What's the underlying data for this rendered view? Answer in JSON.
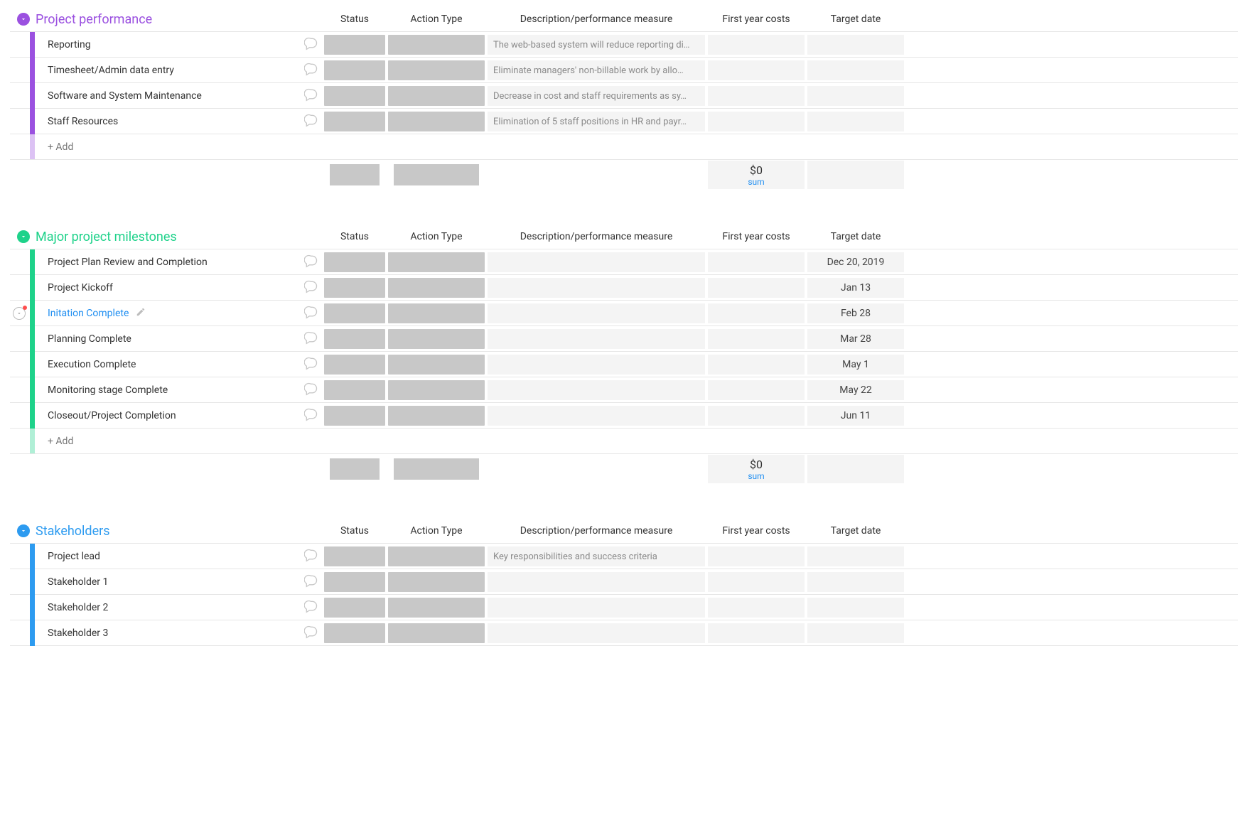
{
  "columns": {
    "status": "Status",
    "action_type": "Action Type",
    "description": "Description/performance measure",
    "first_year_costs": "First year costs",
    "target_date": "Target date"
  },
  "add_label": "+ Add",
  "summary": {
    "value": "$0",
    "label": "sum"
  },
  "groups": [
    {
      "id": "project-performance",
      "title": "Project performance",
      "title_color": "#9b51e0",
      "bar_color": "#9b51e0",
      "rows": [
        {
          "name": "Reporting",
          "description": "The web-based system will reduce reporting di…",
          "target_date": ""
        },
        {
          "name": "Timesheet/Admin data entry",
          "description": "Eliminate managers' non-billable work by allo…",
          "target_date": ""
        },
        {
          "name": "Software and System Maintenance",
          "description": "Decrease in cost and staff requirements as sy…",
          "target_date": ""
        },
        {
          "name": "Staff Resources",
          "description": "Elimination of 5 staff positions in HR and payr…",
          "target_date": ""
        }
      ],
      "show_summary": true
    },
    {
      "id": "major-project-milestones",
      "title": "Major project milestones",
      "title_color": "#1ed28a",
      "bar_color": "#1ed28a",
      "rows": [
        {
          "name": "Project Plan Review and Completion",
          "description": "",
          "target_date": "Dec 20, 2019"
        },
        {
          "name": "Project Kickoff",
          "description": "",
          "target_date": "Jan 13"
        },
        {
          "name": "Initation Complete",
          "description": "",
          "target_date": "Feb 28",
          "active": true
        },
        {
          "name": "Planning Complete",
          "description": "",
          "target_date": "Mar 28"
        },
        {
          "name": "Execution Complete",
          "description": "",
          "target_date": "May 1"
        },
        {
          "name": "Monitoring stage Complete",
          "description": "",
          "target_date": "May 22"
        },
        {
          "name": "Closeout/Project Completion",
          "description": "",
          "target_date": "Jun 11"
        }
      ],
      "show_summary": true
    },
    {
      "id": "stakeholders",
      "title": "Stakeholders",
      "title_color": "#2d9bf0",
      "bar_color": "#2d9bf0",
      "rows": [
        {
          "name": "Project lead",
          "description": "Key responsibilities and success criteria",
          "target_date": ""
        },
        {
          "name": "Stakeholder 1",
          "description": "",
          "target_date": ""
        },
        {
          "name": "Stakeholder 2",
          "description": "",
          "target_date": ""
        },
        {
          "name": "Stakeholder 3",
          "description": "",
          "target_date": ""
        }
      ],
      "show_summary": false
    }
  ]
}
